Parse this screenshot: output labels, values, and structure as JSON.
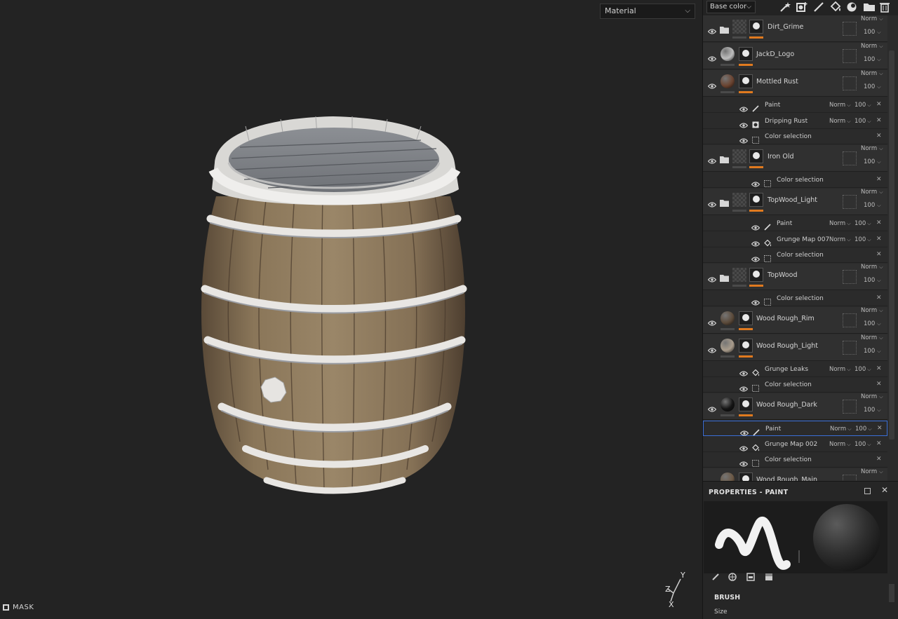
{
  "viewport": {
    "display_mode": "Material",
    "mask_label": "MASK",
    "axis": {
      "y": "Y",
      "z": "Z",
      "x": "X"
    }
  },
  "toolbar": {
    "channel": "Base color",
    "tools": [
      "magic-wand-icon",
      "add-layer-icon",
      "paint-brush-icon",
      "fill-bucket-icon",
      "smart-material-icon",
      "folder-icon",
      "trash-icon"
    ]
  },
  "layers": [
    {
      "name": "Dirt_Grime",
      "type": "folder",
      "blend": "Norm",
      "opacity": "100",
      "thumb": "checker",
      "effects": []
    },
    {
      "name": "JackD_Logo",
      "type": "fill",
      "blend": "Norm",
      "opacity": "100",
      "thumb": "#bdbdbd",
      "effects": []
    },
    {
      "name": "Mottled Rust",
      "type": "fill",
      "blend": "Norm",
      "opacity": "100",
      "thumb": "#6a4330",
      "effects": [
        {
          "name": "Paint",
          "icon": "brush",
          "blend": "Norm",
          "opacity": "100"
        },
        {
          "name": "Dripping Rust",
          "icon": "mask",
          "blend": "Norm",
          "opacity": "100"
        },
        {
          "name": "Color selection",
          "icon": "dotted",
          "blend": "",
          "opacity": ""
        }
      ]
    },
    {
      "name": "Iron Old",
      "type": "folder",
      "blend": "Norm",
      "opacity": "100",
      "thumb": "checker",
      "effects": [
        {
          "name": "Color selection",
          "icon": "dotted",
          "blend": "",
          "opacity": ""
        }
      ]
    },
    {
      "name": "TopWood_Light",
      "type": "folder",
      "blend": "Norm",
      "opacity": "100",
      "thumb": "checker",
      "effects": [
        {
          "name": "Paint",
          "icon": "brush",
          "blend": "Norm",
          "opacity": "100"
        },
        {
          "name": "Grunge Map 007",
          "icon": "fill",
          "blend": "Norm",
          "opacity": "100"
        },
        {
          "name": "Color selection",
          "icon": "dotted",
          "blend": "",
          "opacity": ""
        }
      ]
    },
    {
      "name": "TopWood",
      "type": "folder",
      "blend": "Norm",
      "opacity": "100",
      "thumb": "checker",
      "effects": [
        {
          "name": "Color selection",
          "icon": "dotted",
          "blend": "",
          "opacity": ""
        }
      ]
    },
    {
      "name": "Wood Rough_Rim",
      "type": "fill",
      "blend": "Norm",
      "opacity": "100",
      "thumb": "#5b4a3a",
      "effects": []
    },
    {
      "name": "Wood Rough_Light",
      "type": "fill",
      "blend": "Norm",
      "opacity": "100",
      "thumb": "#a99c8c",
      "effects": [
        {
          "name": "Grunge Leaks",
          "icon": "fill",
          "blend": "Norm",
          "opacity": "100"
        },
        {
          "name": "Color selection",
          "icon": "dotted",
          "blend": "",
          "opacity": ""
        }
      ]
    },
    {
      "name": "Wood Rough_Dark",
      "type": "fill",
      "blend": "Norm",
      "opacity": "100",
      "thumb": "#141414",
      "effects": [
        {
          "name": "Paint",
          "icon": "brush",
          "blend": "Norm",
          "opacity": "100",
          "selected": true
        },
        {
          "name": "Grunge Map 002",
          "icon": "fill",
          "blend": "Norm",
          "opacity": "100"
        },
        {
          "name": "Color selection",
          "icon": "dotted",
          "blend": "",
          "opacity": ""
        }
      ]
    },
    {
      "name": "Wood Rough_Main",
      "type": "fill",
      "blend": "Norm",
      "opacity": "100",
      "thumb": "#6b5845",
      "effects": []
    }
  ],
  "properties": {
    "title": "PROPERTIES - PAINT",
    "brush_section": "BRUSH",
    "size_label": "Size"
  },
  "colors": {
    "accent_orange": "#e07a1f",
    "selection_blue": "#3a6fd8",
    "panel_bg": "#2b2b2b",
    "viewport_bg": "#232323"
  }
}
